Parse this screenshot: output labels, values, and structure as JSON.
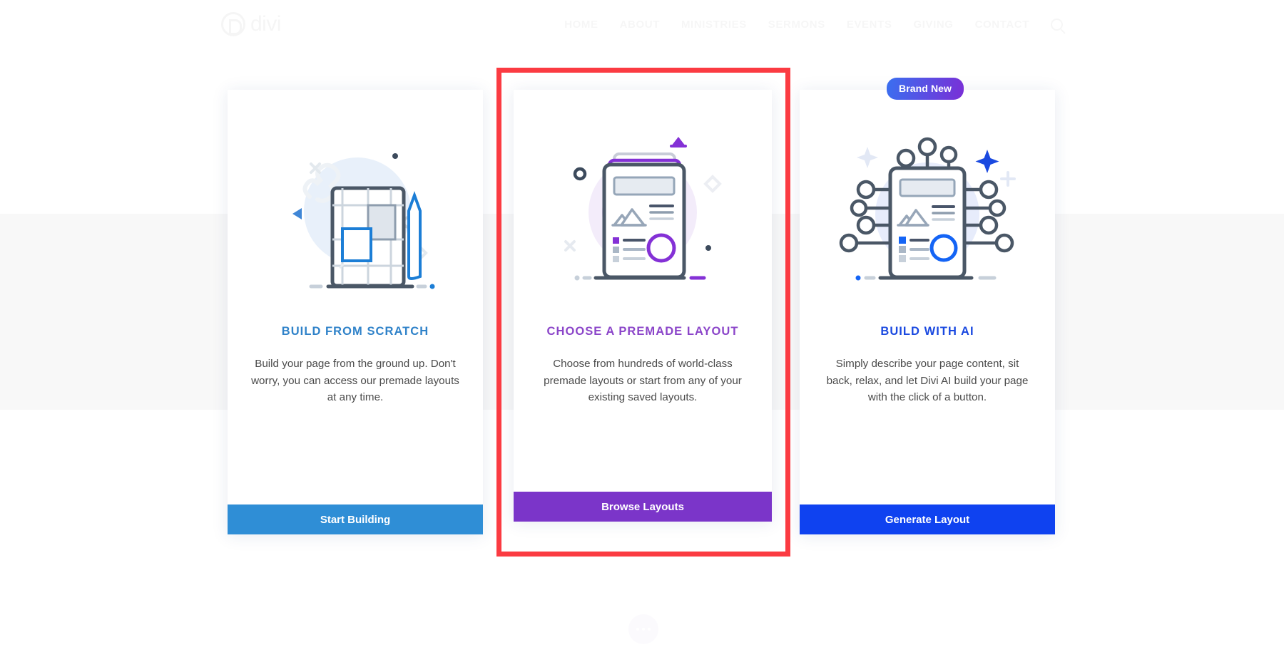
{
  "site": {
    "logo_text": "divi",
    "logo_icon": "divi-logo-icon",
    "nav": [
      {
        "label": "HOME"
      },
      {
        "label": "ABOUT"
      },
      {
        "label": "MINISTRIES"
      },
      {
        "label": "SERMONS"
      },
      {
        "label": "EVENTS"
      },
      {
        "label": "GIVING"
      },
      {
        "label": "CONTACT"
      }
    ],
    "search_icon": "search-icon"
  },
  "overlay": {
    "highlight_color": "#fb3b42",
    "badge": {
      "label": "Brand New",
      "gradient_from": "#3a6ff0",
      "gradient_to": "#7a2fd6"
    },
    "cards": [
      {
        "id": "build-from-scratch",
        "title": "BUILD FROM SCRATCH",
        "title_color": "#2f82c9",
        "body": "Build your page from the ground up. Don't worry, you can access our premade layouts at any time.",
        "button_label": "Start Building",
        "button_color": "#2f8ed6",
        "illustration": "blueprint-grid-illustration"
      },
      {
        "id": "choose-premade-layout",
        "title": "CHOOSE A PREMADE LAYOUT",
        "title_color": "#8b45c9",
        "body": "Choose from hundreds of world-class premade layouts or start from any of your existing saved layouts.",
        "button_label": "Browse Layouts",
        "button_color": "#7b35c9",
        "illustration": "stacked-layouts-illustration",
        "highlighted": true
      },
      {
        "id": "build-with-ai",
        "title": "BUILD WITH AI",
        "title_color": "#1a49e0",
        "body": "Simply describe your page content, sit back, relax, and let Divi AI build your page with the click of a button.",
        "button_label": "Generate Layout",
        "button_color": "#0f42f0",
        "illustration": "ai-circuit-layout-illustration",
        "badge": "Brand New"
      }
    ]
  }
}
